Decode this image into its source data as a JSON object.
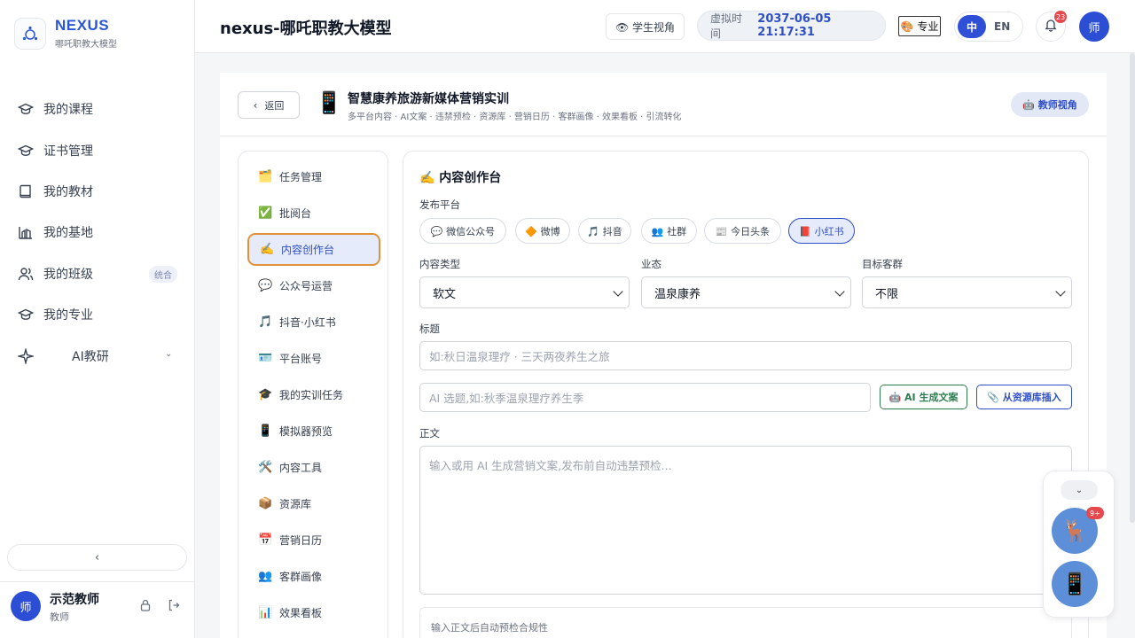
{
  "brand": {
    "name": "NEXUS",
    "subtitle": "哪吒职教大模型"
  },
  "sidebar": {
    "items": [
      {
        "label": "我的课程",
        "icon": "graduation-cap-icon"
      },
      {
        "label": "证书管理",
        "icon": "graduation-cap-icon"
      },
      {
        "label": "我的教材",
        "icon": "book-icon"
      },
      {
        "label": "我的基地",
        "icon": "building-chart-icon"
      },
      {
        "label": "我的班级",
        "icon": "users-icon",
        "badge": "统合"
      },
      {
        "label": "我的专业",
        "icon": "graduation-cap-icon"
      },
      {
        "label": "AI教研",
        "icon": "sparkle-icon"
      }
    ],
    "collapse_label": "‹"
  },
  "user": {
    "avatar": "师",
    "name": "示范教师",
    "role": "教师"
  },
  "header": {
    "title": "nexus-哪吒职教大模型",
    "student_view": "👁 学生视角",
    "virtual_time_label": "虚拟时间",
    "virtual_time_value": "2037-06-05 21:17:31",
    "pro_label": "🎨 专业",
    "lang_zh": "中",
    "lang_en": "EN",
    "notification_count": "23",
    "avatar": "师"
  },
  "course": {
    "back_label": "返回",
    "icon": "📱",
    "title": "智慧康养旅游新媒体营销实训",
    "subtitle": "多平台内容 · AI文案 · 违禁预检 · 资源库 · 营销日历 · 客群画像 · 效果看板 · 引流转化",
    "teacher_view": "🤖 教师视角"
  },
  "modules": [
    {
      "icon": "🗂️",
      "label": "任务管理"
    },
    {
      "icon": "✅",
      "label": "批阅台"
    },
    {
      "icon": "✍️",
      "label": "内容创作台",
      "active": true
    },
    {
      "icon": "💬",
      "label": "公众号运营"
    },
    {
      "icon": "🎵",
      "label": "抖音·小红书"
    },
    {
      "icon": "🪪",
      "label": "平台账号"
    },
    {
      "icon": "🎓",
      "label": "我的实训任务"
    },
    {
      "icon": "📱",
      "label": "模拟器预览"
    },
    {
      "icon": "🛠️",
      "label": "内容工具"
    },
    {
      "icon": "📦",
      "label": "资源库"
    },
    {
      "icon": "📅",
      "label": "营销日历"
    },
    {
      "icon": "👥",
      "label": "客群画像"
    },
    {
      "icon": "📊",
      "label": "效果看板"
    }
  ],
  "editor": {
    "title": "✍️ 内容创作台",
    "platform_label": "发布平台",
    "platforms": [
      {
        "label": "💬 微信公众号"
      },
      {
        "label": "🔶 微博"
      },
      {
        "label": "🎵 抖音"
      },
      {
        "label": "👥 社群"
      },
      {
        "label": "📰 今日头条"
      },
      {
        "label": "📕 小红书",
        "active": true
      }
    ],
    "content_type_label": "内容类型",
    "content_type_value": "软文",
    "business_label": "业态",
    "business_value": "温泉康养",
    "audience_label": "目标客群",
    "audience_value": "不限",
    "headline_label": "标题",
    "headline_placeholder": "如:秋日温泉理疗 · 三天两夜养生之旅",
    "topic_placeholder": "AI 选题,如:秋季温泉理疗养生季",
    "ai_generate": "🤖 AI 生成文案",
    "insert_resource": "📎 从资源库插入",
    "body_label": "正文",
    "body_placeholder": "输入或用 AI 生成营销文案,发布前自动违禁预检...",
    "check_hint": "输入正文后自动预检合规性"
  },
  "float": {
    "chevron": "⌄",
    "badge": "9+",
    "avatar1": "🦌",
    "avatar2": "📱"
  },
  "colors": {
    "accent": "#2f4fc7",
    "active_border": "#e0923a",
    "ai_green": "#2e7d4f",
    "badge_red": "#e5484d"
  }
}
